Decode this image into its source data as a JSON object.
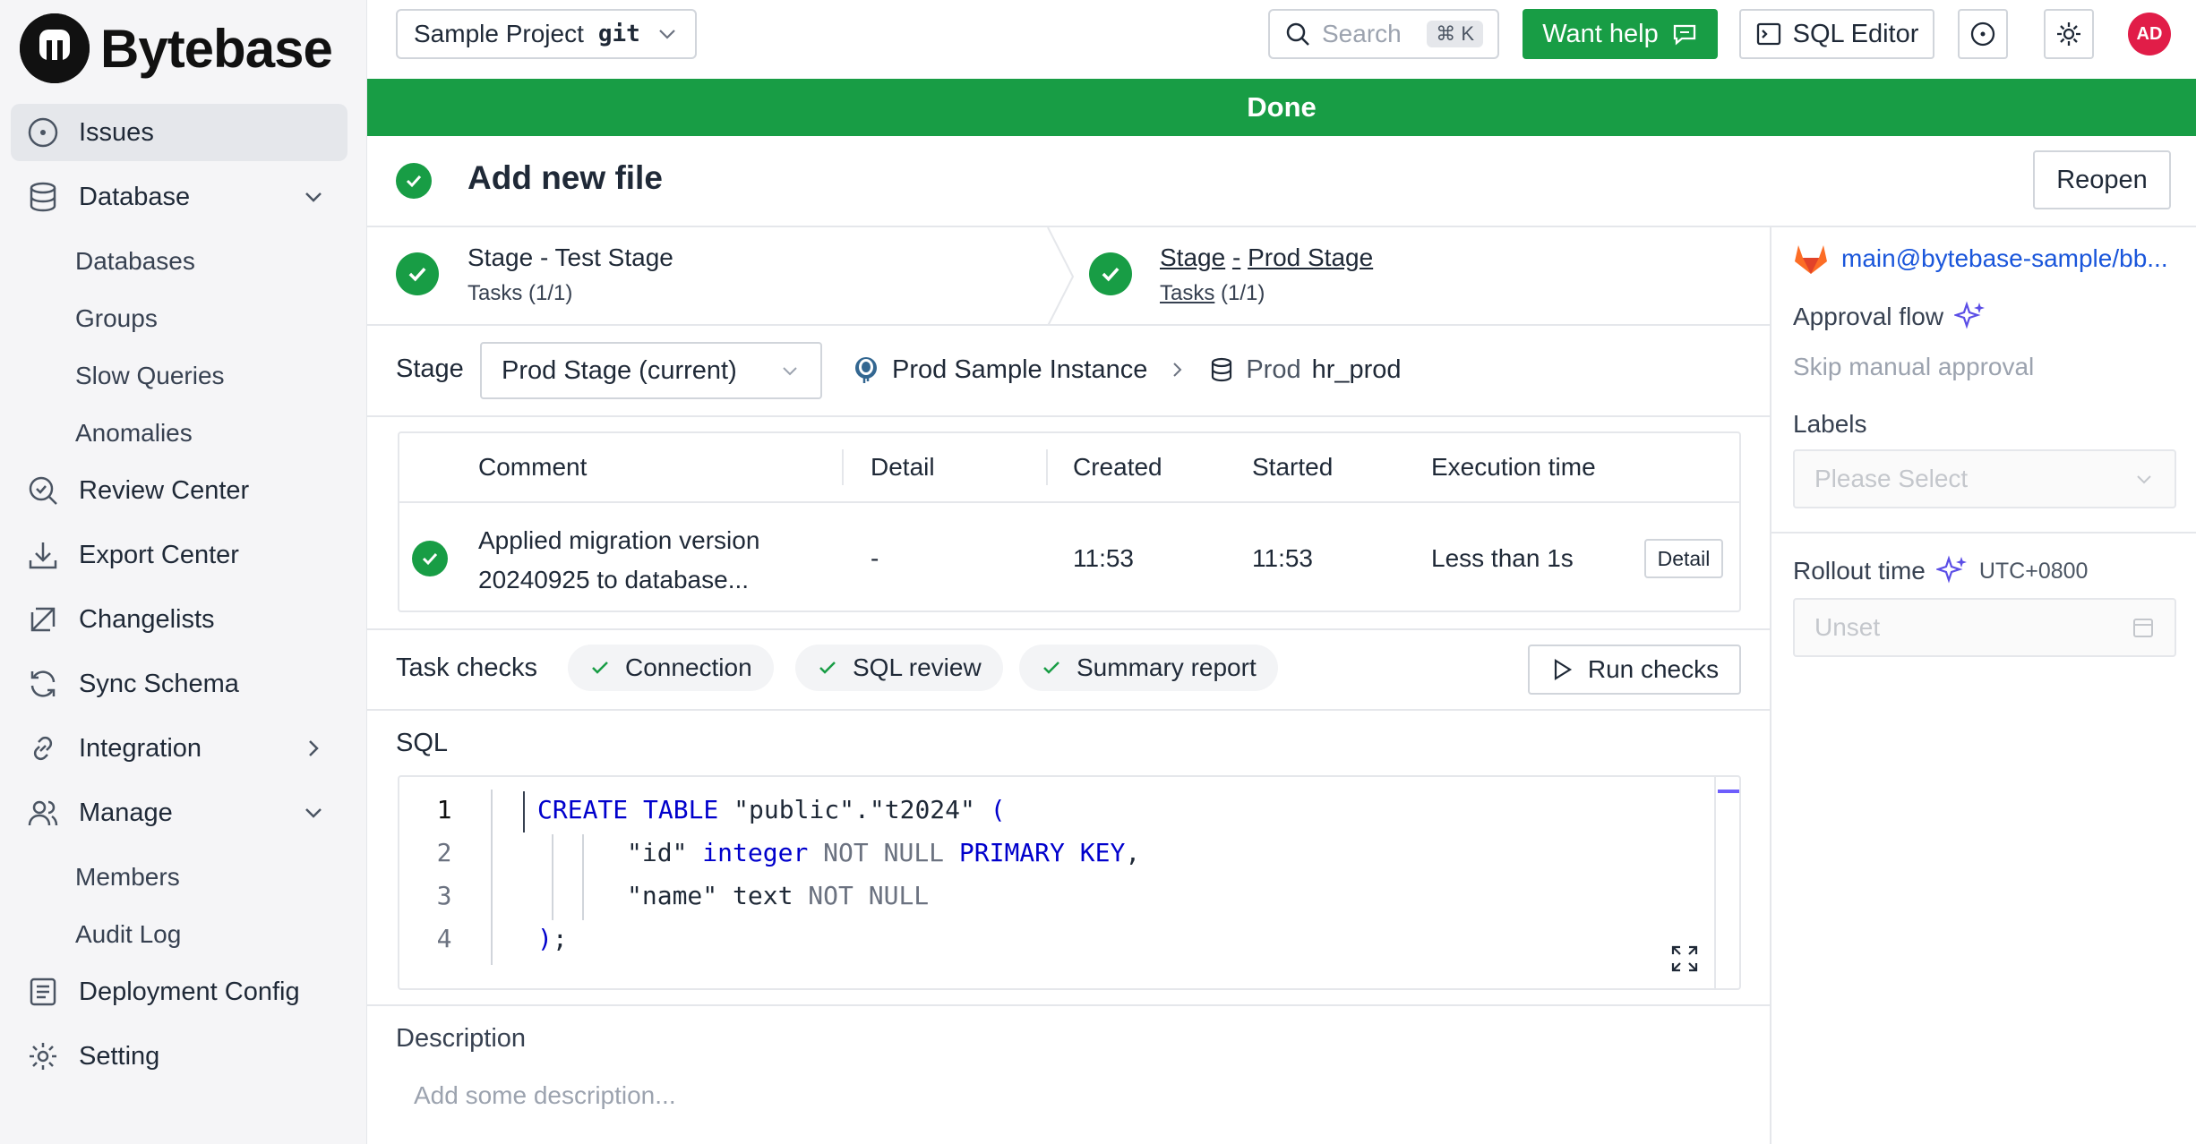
{
  "brand": {
    "name": "Bytebase"
  },
  "sidebar": {
    "items": [
      {
        "label": "Issues",
        "icon": "issues-icon",
        "active": true
      },
      {
        "label": "Database",
        "icon": "database-icon",
        "expanded": true,
        "children": [
          "Databases",
          "Groups",
          "Slow Queries",
          "Anomalies"
        ]
      },
      {
        "label": "Review Center",
        "icon": "review-icon"
      },
      {
        "label": "Export Center",
        "icon": "export-icon"
      },
      {
        "label": "Changelists",
        "icon": "changelists-icon"
      },
      {
        "label": "Sync Schema",
        "icon": "sync-icon"
      },
      {
        "label": "Integration",
        "icon": "integration-icon",
        "collapsed": true
      },
      {
        "label": "Manage",
        "icon": "manage-icon",
        "expanded": true,
        "children": [
          "Members",
          "Audit Log"
        ]
      },
      {
        "label": "Deployment Config",
        "icon": "deployment-icon"
      },
      {
        "label": "Setting",
        "icon": "gear-icon"
      }
    ]
  },
  "header": {
    "project": "Sample Project",
    "project_tag": "git",
    "search_placeholder": "Search",
    "search_shortcut": "⌘ K",
    "help_label": "Want help",
    "sql_editor_label": "SQL Editor",
    "avatar": "AD"
  },
  "banner": {
    "status": "Done"
  },
  "issue": {
    "title": "Add new file",
    "reopen_label": "Reopen",
    "stages": [
      {
        "name": "Stage - Test Stage",
        "tasks_label": "Tasks",
        "tasks_count": "(1/1)"
      },
      {
        "name_prefix": "Stage",
        "name_sep": "-",
        "name": "Prod Stage",
        "tasks_label": "Tasks",
        "tasks_count": "(1/1)"
      }
    ],
    "stage_label": "Stage",
    "stage_selected": "Prod Stage (current)",
    "instance": "Prod Sample Instance",
    "db_env": "Prod",
    "db_name": "hr_prod",
    "table": {
      "headers": [
        "Comment",
        "Detail",
        "Created",
        "Started",
        "Execution time"
      ],
      "row": {
        "comment_line1": "Applied migration version",
        "comment_line2": "20240925 to database...",
        "detail": "-",
        "created": "11:53",
        "started": "11:53",
        "execution": "Less than 1s",
        "detail_button": "Detail"
      }
    },
    "task_checks": {
      "label": "Task checks",
      "chips": [
        "Connection",
        "SQL review",
        "Summary report"
      ],
      "run_label": "Run checks"
    },
    "sql_label": "SQL",
    "line_numbers": [
      "1",
      "2",
      "3",
      "4"
    ],
    "sql": {
      "l1": [
        "CREATE TABLE",
        " \"public\".\"t2024\" ",
        "("
      ],
      "l2": [
        "\"id\" ",
        "integer",
        " NOT NULL ",
        "PRIMARY KEY",
        ","
      ],
      "l3": [
        "\"name\" text ",
        "NOT NULL"
      ],
      "l4": [
        ")",
        ";"
      ]
    },
    "description_label": "Description",
    "description_placeholder": "Add some description..."
  },
  "right_panel": {
    "repo_link": "main@bytebase-sample/bb...",
    "approval_flow_label": "Approval flow",
    "approval_flow_value": "Skip manual approval",
    "labels_label": "Labels",
    "labels_placeholder": "Please Select",
    "rollout_label": "Rollout time",
    "timezone": "UTC+0800",
    "rollout_placeholder": "Unset"
  },
  "colors": {
    "success": "#189d45",
    "accent_link": "#1a56db",
    "sparkle": "#5b4ee6"
  }
}
